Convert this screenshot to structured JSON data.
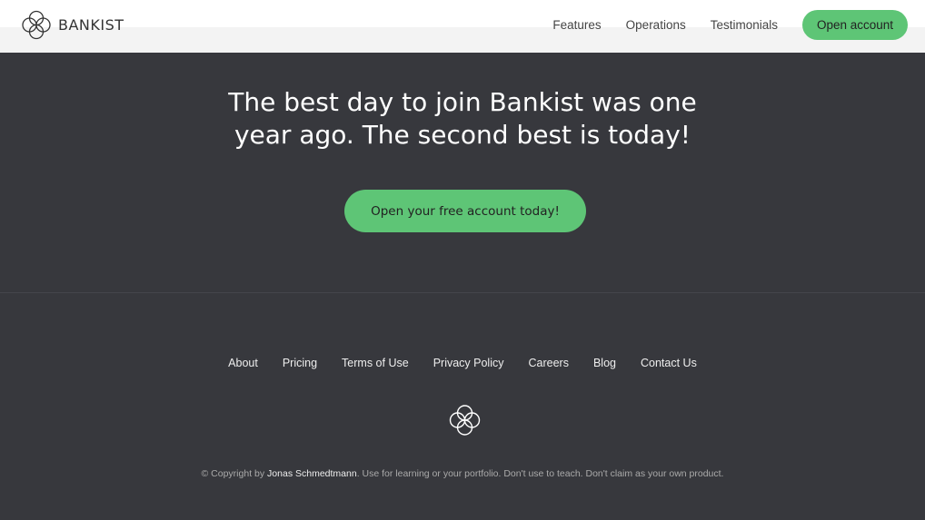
{
  "header": {
    "logo_text": "BANKIST",
    "nav": {
      "features": "Features",
      "operations": "Operations",
      "testimonials": "Testimonials",
      "open_account": "Open account"
    }
  },
  "signup": {
    "title_line1": "The best day to join Bankist was one",
    "title_line2": "year ago. The second best is today!",
    "cta": "Open your free account today!"
  },
  "footer": {
    "links": {
      "about": "About",
      "pricing": "Pricing",
      "terms": "Terms of Use",
      "privacy": "Privacy Policy",
      "careers": "Careers",
      "blog": "Blog",
      "contact": "Contact Us"
    },
    "copyright_prefix": "© Copyright by",
    "copyright_author": "Jonas Schmedtmann",
    "copyright_suffix": ". Use for learning or your portfolio. Don't use to teach. Don't claim as your own product."
  },
  "colors": {
    "accent": "#5ec576",
    "dark_bg": "#37383d",
    "header_bg": "#ffffff"
  },
  "icons": {
    "logo": "bankist-clover-logo-icon",
    "footer_logo": "bankist-clover-logo-icon"
  }
}
